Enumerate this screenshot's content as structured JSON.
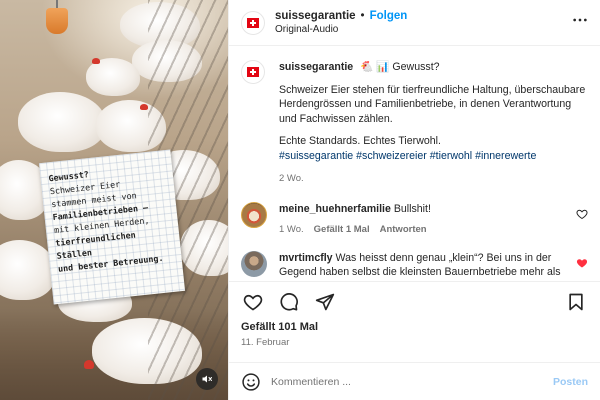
{
  "header": {
    "username": "suissegarantie",
    "separator": "•",
    "follow_label": "Folgen",
    "audio": "Original-Audio",
    "more_icon": "more-horizontal-icon"
  },
  "media": {
    "note_lines": [
      {
        "text": "Gewusst?",
        "strong": true
      },
      {
        "text": "Schweizer Eier",
        "strong": false
      },
      {
        "text": "stammen meist von",
        "strong": false
      },
      {
        "text": "Familienbetrieben –",
        "strong": true
      },
      {
        "text": "mit kleinen Herden,",
        "strong": false
      },
      {
        "text": "tierfreundlichen Ställen",
        "strong": true
      },
      {
        "text": "und bester Betreuung.",
        "strong": true
      }
    ],
    "mute_icon": "speaker-muted-icon"
  },
  "caption": {
    "username": "suissegarantie",
    "first_line": "🐔 📊 Gewusst?",
    "para1": "Schweizer Eier stehen für tierfreundliche Haltung, überschaubare Herdengrössen und Familienbetriebe, in denen Verantwortung und Fachwissen zählen.",
    "para2": "Echte Standards. Echtes Tierwohl.",
    "hashtags": [
      "#suissegarantie",
      "#schweizereier",
      "#tierwohl",
      "#innerewerte"
    ],
    "time": "2 Wo."
  },
  "comments": [
    {
      "username": "meine_huehnerfamilie",
      "text": "Bullshit!",
      "time": "1 Wo.",
      "likes": "Gefällt 1 Mal",
      "reply": "Antworten",
      "liked": false
    },
    {
      "username": "mvrtimcfly",
      "text": "Was heisst denn genau „klein“? Bei uns in der Gegend haben selbst die kleinsten Bauernbetriebe mehr als",
      "liked": true
    }
  ],
  "footer": {
    "likes": "Gefällt 101 Mal",
    "date": "11. Februar",
    "comment_placeholder": "Kommentieren ...",
    "post_label": "Posten"
  },
  "colors": {
    "accent": "#0095f6",
    "liked": "#ff3040",
    "brand_red": "#e30613",
    "hashtag": "#00376b"
  }
}
